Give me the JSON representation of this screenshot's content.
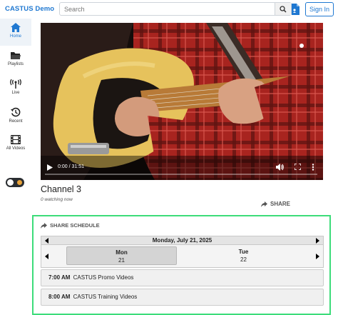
{
  "header": {
    "brand": "CASTUS Demo",
    "search_placeholder": "Search",
    "sign_in_label": "Sign In"
  },
  "sidebar": {
    "items": [
      {
        "label": "Home",
        "icon": "home-icon",
        "active": true
      },
      {
        "label": "Playlists",
        "icon": "folder-icon",
        "active": false
      },
      {
        "label": "Live",
        "icon": "antenna-icon",
        "active": false
      },
      {
        "label": "Recent",
        "icon": "history-icon",
        "active": false
      },
      {
        "label": "All Videos",
        "icon": "film-icon",
        "active": false
      }
    ],
    "theme_toggle": "dark-mode-toggle"
  },
  "player": {
    "time": "0:00 / 31:51"
  },
  "channel": {
    "title": "Channel 3",
    "watching": "0 watching now",
    "share_label": "SHARE"
  },
  "schedule": {
    "header": "SHARE SCHEDULE",
    "date": "Monday, July 21, 2025",
    "days": [
      {
        "name": "Mon",
        "num": "21",
        "selected": true
      },
      {
        "name": "Tue",
        "num": "22",
        "selected": false
      }
    ],
    "programs": [
      {
        "time": "7:00 AM",
        "title": "CASTUS Promo Videos"
      },
      {
        "time": "8:00 AM",
        "title": "CASTUS Training Videos"
      }
    ]
  },
  "colors": {
    "accent": "#1f78d1",
    "schedule_border": "#3ddc7a",
    "toggle_dot": "#e8a23a"
  }
}
